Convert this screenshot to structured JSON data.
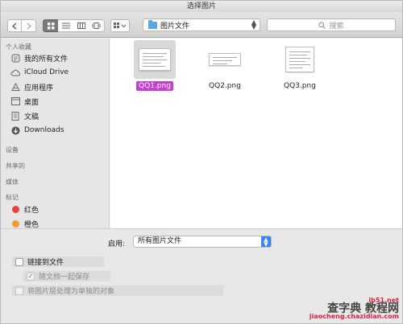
{
  "window": {
    "title": "选择图片"
  },
  "toolbar": {
    "location": "图片文件",
    "search_placeholder": "搜索"
  },
  "sidebar": {
    "favorites_title": "个人收藏",
    "favorites": [
      {
        "label": "我的所有文件",
        "icon": "all-files-icon"
      },
      {
        "label": "iCloud Drive",
        "icon": "cloud-icon"
      },
      {
        "label": "应用程序",
        "icon": "applications-icon"
      },
      {
        "label": "桌面",
        "icon": "desktop-icon"
      },
      {
        "label": "文稿",
        "icon": "documents-icon"
      },
      {
        "label": "Downloads",
        "icon": "downloads-icon"
      }
    ],
    "devices_title": "设备",
    "shared_title": "共享的",
    "media_title": "媒体",
    "tags_title": "标记",
    "tags": [
      {
        "label": "红色",
        "color": "#e8423c"
      },
      {
        "label": "橙色",
        "color": "#f29a2e"
      }
    ]
  },
  "files": [
    {
      "name": "QQ1.png",
      "selected": true
    },
    {
      "name": "QQ2.png",
      "selected": false
    },
    {
      "name": "QQ3.png",
      "selected": false
    }
  ],
  "options": {
    "enable_label": "启用:",
    "enable_value": "所有图片文件",
    "link_to_file": "链接到文件",
    "save_with_doc": "随文档一起保存",
    "save_with_doc_checked": true,
    "separate_objects": "将图片层处理为单独的对象"
  },
  "watermark": {
    "line1": "ib51.net",
    "line2": "查字典 教程网",
    "line3": "jiaocheng.chazidian.com"
  }
}
